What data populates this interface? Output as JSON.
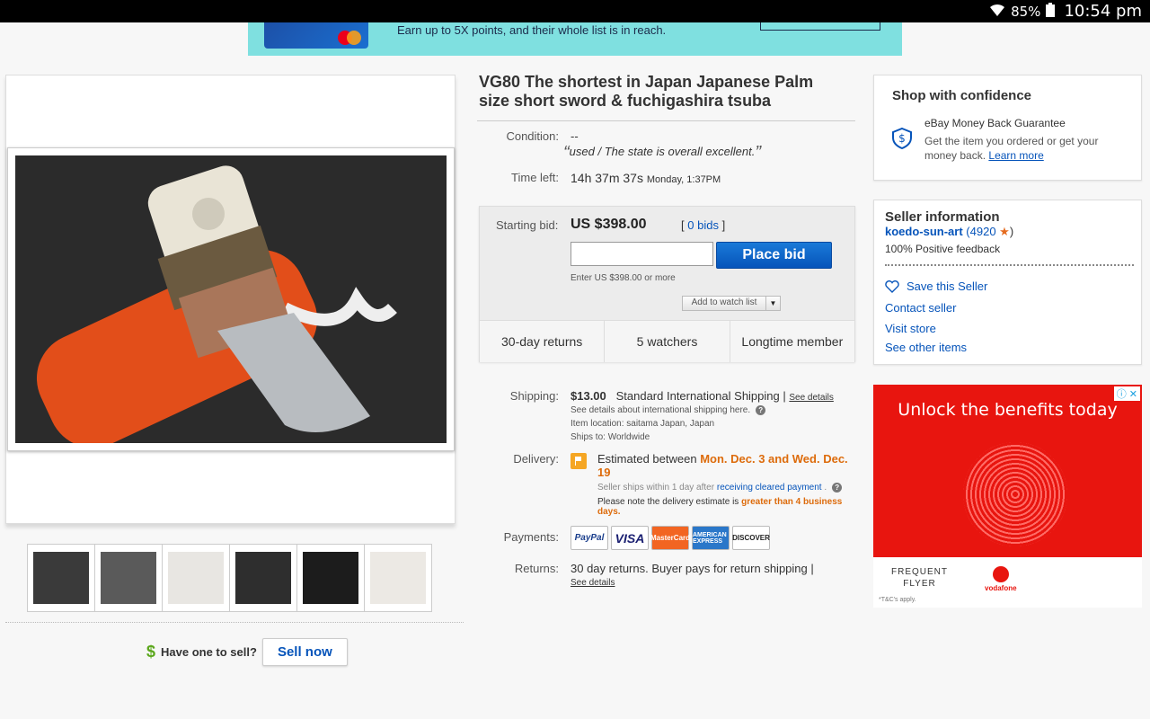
{
  "status_bar": {
    "battery": "85%",
    "time": "10:54 pm"
  },
  "top_ad": {
    "text": "Earn up to 5X points, and their whole list is in reach."
  },
  "listing": {
    "title": "VG80 The shortest in Japan Japanese Palm size short sword & fuchigashira tsuba",
    "condition_label": "Condition:",
    "condition_value": "--",
    "condition_note": "used / The state is overall excellent.",
    "time_left_label": "Time left:",
    "time_left": "14h 37m 37s",
    "time_left_end": "Monday, 1:37PM"
  },
  "bid_box": {
    "starting_bid_label": "Starting bid:",
    "starting_bid": "US $398.00",
    "bids_open": "[",
    "bids_link": "0 bids",
    "bids_close": "]",
    "input_placeholder": "",
    "place_bid": "Place bid",
    "hint": "Enter US $398.00 or more",
    "watch_label": "Add to watch list",
    "stats": [
      "30-day returns",
      "5 watchers",
      "Longtime member"
    ]
  },
  "shipping": {
    "label": "Shipping:",
    "price": "$13.00",
    "service": "Standard International Shipping |",
    "see_details": "See details",
    "intl_note": "See details about international shipping here.",
    "item_location": "Item location:  saitama Japan, Japan",
    "ships_to": "Ships to:  Worldwide"
  },
  "delivery": {
    "label": "Delivery:",
    "estimated_prefix": "Estimated between",
    "estimated_dates": "Mon. Dec. 3 and Wed. Dec. 19",
    "ships_within": "Seller ships within 1 day after",
    "cleared_payment_link": "receiving cleared payment",
    "ships_within_end": ".",
    "note_prefix": "Please note the delivery estimate is",
    "note_highlight": "greater than 4 business days."
  },
  "payments": {
    "label": "Payments:",
    "methods": [
      "PayPal",
      "VISA",
      "MasterCard",
      "AMERICAN EXPRESS",
      "DISCOVER"
    ]
  },
  "returns": {
    "label": "Returns:",
    "text": "30 day returns. Buyer pays for return shipping |",
    "see_details": "See details"
  },
  "sell": {
    "question": "Have one to sell?",
    "button": "Sell now",
    "dollar": "$"
  },
  "confidence": {
    "heading": "Shop with confidence",
    "guarantee": "eBay Money Back Guarantee",
    "desc": "Get the item you ordered or get your money back.",
    "learn_more": "Learn more"
  },
  "seller": {
    "heading": "Seller information",
    "name": "koedo-sun-art",
    "score_open": "(4920",
    "score_close": ")",
    "feedback": "100% Positive feedback",
    "save": "Save this Seller",
    "contact": "Contact seller",
    "store": "Visit store",
    "other_items": "See other items"
  },
  "right_ad": {
    "headline": "Unlock the benefits today",
    "ff_line1": "FREQUENT",
    "ff_line2": "FLYER",
    "vodafone": "vodafone",
    "tc": "*T&C's apply."
  },
  "colors": {
    "link": "#0654ba",
    "accent_orange": "#dd6b0b",
    "place_bid": "#0654ba",
    "ad_red": "#e8150f"
  }
}
